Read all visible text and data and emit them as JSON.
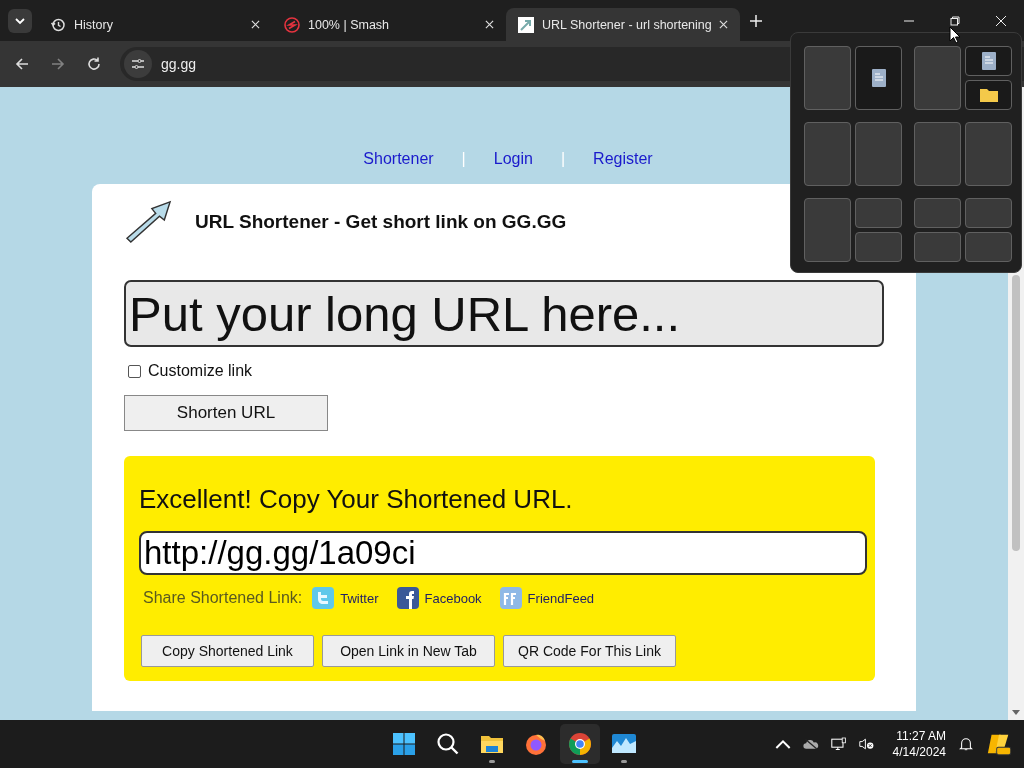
{
  "browser": {
    "tabs": [
      {
        "title": "History",
        "kind": "history",
        "selected": false
      },
      {
        "title": "100% | Smash",
        "kind": "smash",
        "selected": false
      },
      {
        "title": "URL Shortener - url shortening",
        "kind": "site",
        "selected": true
      }
    ],
    "nav_buttons": [
      {
        "kind": "back",
        "disabled": false
      },
      {
        "kind": "forward",
        "disabled": true
      },
      {
        "kind": "reload",
        "disabled": false
      }
    ],
    "address": "gg.gg"
  },
  "nav": [
    {
      "kind": "link",
      "label": "Shortener"
    },
    {
      "kind": "separator",
      "label": "|"
    },
    {
      "kind": "link",
      "label": "Login"
    },
    {
      "kind": "separator",
      "label": "|"
    },
    {
      "kind": "link",
      "label": "Register"
    }
  ],
  "header": {
    "title": "URL Shortener - Get short link on GG.GG"
  },
  "url_field": {
    "placeholder": "Put your long URL here..."
  },
  "customize": {
    "label": "Customize link",
    "checked": false
  },
  "shorten_button": "Shorten URL",
  "result": {
    "heading": "Excellent! Copy Your Shortened URL.",
    "value": "http://gg.gg/1a09ci",
    "share_label": "Share Shortened Link:",
    "share_links": [
      {
        "label": "Twitter",
        "kind": "twitter"
      },
      {
        "label": "Facebook",
        "kind": "facebook"
      },
      {
        "label": "FriendFeed",
        "kind": "friendfeed"
      }
    ],
    "buttons": [
      "Copy Shortened Link",
      "Open Link in New Tab",
      "QR Code For This Link"
    ]
  },
  "snap_layouts": {
    "open": true
  },
  "taskbar": {
    "apps": [
      {
        "kind": "start",
        "running": false,
        "selected": false
      },
      {
        "kind": "search",
        "running": false,
        "selected": false
      },
      {
        "kind": "files",
        "running": true,
        "selected": false
      },
      {
        "kind": "firefox",
        "running": false,
        "selected": false
      },
      {
        "kind": "chrome",
        "running": true,
        "selected": true
      },
      {
        "kind": "photos",
        "running": true,
        "selected": false
      }
    ],
    "time": "11:27 AM",
    "date": "4/14/2024"
  }
}
